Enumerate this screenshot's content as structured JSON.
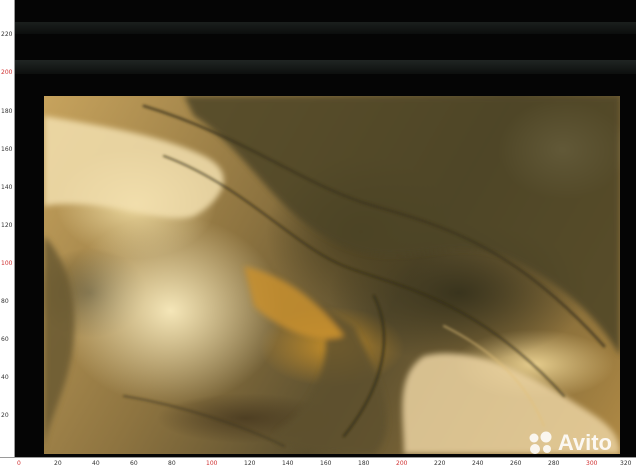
{
  "image": {
    "subject": "marble-slab-photo",
    "colors": {
      "background": "#050505",
      "slab_dark": "#5a4e2e",
      "slab_light": "#f5e6bf",
      "vein_gold": "#c89a3a"
    }
  },
  "ruler_left": {
    "labels": [
      {
        "text": "220",
        "red": false
      },
      {
        "text": "200",
        "red": true
      },
      {
        "text": "180",
        "red": false
      },
      {
        "text": "160",
        "red": false
      },
      {
        "text": "140",
        "red": false
      },
      {
        "text": "120",
        "red": false
      },
      {
        "text": "100",
        "red": true
      },
      {
        "text": "80",
        "red": false
      },
      {
        "text": "60",
        "red": false
      },
      {
        "text": "40",
        "red": false
      },
      {
        "text": "20",
        "red": false
      }
    ]
  },
  "ruler_bottom": {
    "labels": [
      {
        "text": "0",
        "red": true
      },
      {
        "text": "20",
        "red": false
      },
      {
        "text": "40",
        "red": false
      },
      {
        "text": "60",
        "red": false
      },
      {
        "text": "80",
        "red": false
      },
      {
        "text": "100",
        "red": true
      },
      {
        "text": "120",
        "red": false
      },
      {
        "text": "140",
        "red": false
      },
      {
        "text": "160",
        "red": false
      },
      {
        "text": "180",
        "red": false
      },
      {
        "text": "200",
        "red": true
      },
      {
        "text": "220",
        "red": false
      },
      {
        "text": "240",
        "red": false
      },
      {
        "text": "260",
        "red": false
      },
      {
        "text": "280",
        "red": false
      },
      {
        "text": "300",
        "red": true
      },
      {
        "text": "320",
        "red": false
      }
    ]
  },
  "watermark": {
    "text": "Avito",
    "icon": "avito-logo-icon"
  }
}
